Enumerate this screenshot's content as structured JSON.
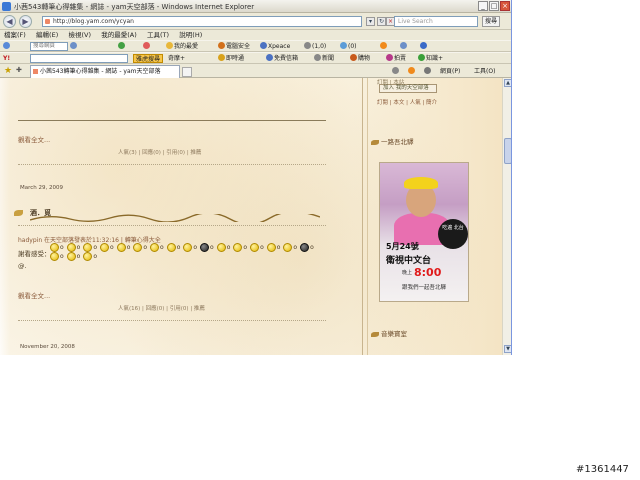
{
  "window": {
    "title": "小茜543轉筆心得雜集 - 網誌 - yam天空部落 - Windows Internet Explorer",
    "buttons": {
      "minimize": "_",
      "maximize": "□",
      "close": "×"
    }
  },
  "addressbar": {
    "url": "http://blog.yam.com/ycyan",
    "search_placeholder": "Live Search",
    "search_button": "搜尋"
  },
  "menubar": {
    "items": [
      "檔案(F)",
      "編輯(E)",
      "檢視(V)",
      "我的最愛(A)",
      "工具(T)",
      "說明(H)"
    ]
  },
  "toolbar1": {
    "search_value": "搜尋網頁",
    "items": [
      "我的最愛",
      "電腦安全",
      "Xpeace",
      "(1,0)",
      "(0)"
    ]
  },
  "toolbar2": {
    "items": [
      "雅虎搜尋",
      "奇摩+",
      "即時通",
      "免費信箱",
      "新聞",
      "購物",
      "拍賣",
      "知識+"
    ],
    "right_items": [
      "網頁(P)",
      "工具(O)"
    ]
  },
  "tab": {
    "label": "小茜543轉筆心得雜集 - 網誌 - yam天空部落"
  },
  "content": {
    "more_link_1": "觀看全文...",
    "meta_1": "人氣(3) | 回應(0) | 引用(0) | 推薦",
    "date_1": "March 29, 2009",
    "post_title": "酒．覓",
    "author_line": "hadypin 在天空部落發表於11:32:16 | 轉筆心得大全",
    "body_prefix": "謝看感受：",
    "body_suffix": "@.",
    "more_link_2": "觀看全文...",
    "meta_2": "人氣(16) | 回應(0) | 引用(0) | 推薦",
    "date_2": "November 20, 2008",
    "emoticon_count": 19
  },
  "sidebar": {
    "top_link": "訂閱 | 本站",
    "follow_button": "加入 我的天空部落",
    "subscribe_links": "訂閱 | 本文 | 人氣 | 簡介",
    "head_1": "一路吾北驛",
    "head_2": "音樂寶室",
    "ad": {
      "badge": "吃遍 北台",
      "date": "5月24號",
      "channel": "衛視中文台",
      "time_prefix": "晚上",
      "time": "8:00",
      "cta": "跟我們一起吾北驛"
    }
  },
  "watermark": "#1361447"
}
